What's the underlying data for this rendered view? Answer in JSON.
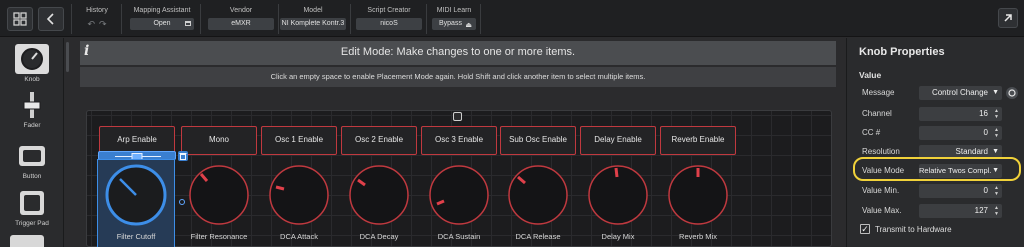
{
  "toolbar": {
    "history_label": "History",
    "undo_icon": "undo-icon",
    "redo_icon": "redo-icon",
    "mapping_assistant_label": "Mapping Assistant",
    "mapping_assistant_value": "Open",
    "vendor_label": "Vendor",
    "vendor_value": "eMXR",
    "model_label": "Model",
    "model_value": "NI Komplete Kontr.3",
    "script_creator_label": "Script Creator",
    "script_creator_value": "nicoS",
    "midi_learn_label": "MIDI Learn",
    "midi_learn_value": "Bypass"
  },
  "palette": {
    "items": [
      {
        "label": "Knob",
        "icon": "knob-icon"
      },
      {
        "label": "Fader",
        "icon": "fader-icon"
      },
      {
        "label": "Button",
        "icon": "button-icon"
      },
      {
        "label": "Trigger Pad",
        "icon": "trigger-pad-icon"
      }
    ]
  },
  "editor": {
    "info_glyph": "i",
    "mode_message": "Edit Mode: Make changes to one or more items.",
    "hint": "Click an empty space to enable Placement Mode again. Hold Shift and click another item to select multiple items."
  },
  "pads": [
    {
      "label": "Arp Enable"
    },
    {
      "label": "Mono"
    },
    {
      "label": "Osc 1 Enable"
    },
    {
      "label": "Osc 2 Enable"
    },
    {
      "label": "Osc 3 Enable"
    },
    {
      "label": "Sub Osc Enable"
    },
    {
      "label": "Delay Enable"
    },
    {
      "label": "Reverb Enable"
    }
  ],
  "knobs": [
    {
      "label": "Filter Cutoff",
      "selected": true
    },
    {
      "label": "Filter Resonance",
      "selected": false
    },
    {
      "label": "DCA Attack",
      "selected": false
    },
    {
      "label": "DCA Decay",
      "selected": false
    },
    {
      "label": "DCA Sustain",
      "selected": false
    },
    {
      "label": "DCA Release",
      "selected": false
    },
    {
      "label": "Delay Mix",
      "selected": false
    },
    {
      "label": "Reverb Mix",
      "selected": false
    }
  ],
  "properties": {
    "title": "Knob Properties",
    "section": "Value",
    "rows": [
      {
        "label": "Message",
        "value": "Control Change",
        "kind": "dropdown"
      },
      {
        "label": "Channel",
        "value": "16",
        "kind": "spinner"
      },
      {
        "label": "CC #",
        "value": "0",
        "kind": "spinner"
      },
      {
        "label": "Resolution",
        "value": "Standard",
        "kind": "dropdown"
      },
      {
        "label": "Value Mode",
        "value": "Relative Twos Compl.",
        "kind": "dropdown"
      },
      {
        "label": "Value Min.",
        "value": "0",
        "kind": "spinner"
      },
      {
        "label": "Value Max.",
        "value": "127",
        "kind": "spinner"
      }
    ],
    "transmit_label": "Transmit to Hardware",
    "transmit_checked": true
  },
  "colors": {
    "accent_blue": "#3d8ee8",
    "pad_red": "#c0393f",
    "knob_indicator": "#e0404a",
    "highlight_yellow": "#f1d23a"
  }
}
